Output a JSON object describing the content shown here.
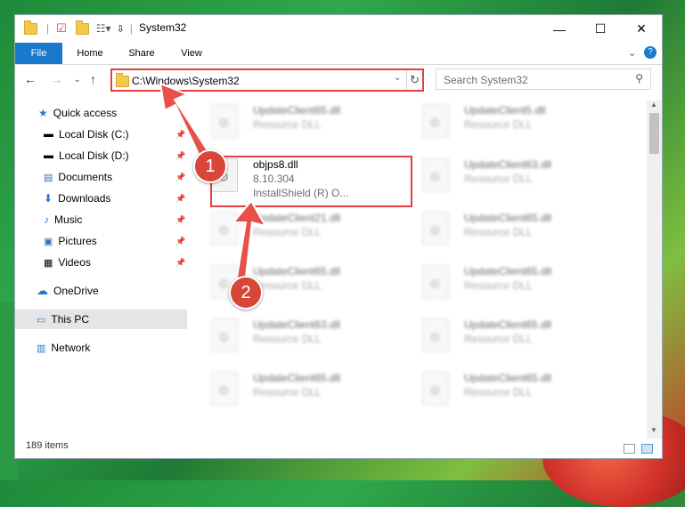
{
  "window": {
    "title": "System32"
  },
  "ribbon": {
    "tabs": [
      "File",
      "Home",
      "Share",
      "View"
    ]
  },
  "address": {
    "path": "C:\\Windows\\System32"
  },
  "search": {
    "placeholder": "Search System32"
  },
  "nav": {
    "quick_access": "Quick access",
    "items": [
      "Local Disk (C:)",
      "Local Disk (D:)",
      "Documents",
      "Downloads",
      "Music",
      "Pictures",
      "Videos"
    ],
    "onedrive": "OneDrive",
    "this_pc": "This PC",
    "network": "Network"
  },
  "files": {
    "highlighted": {
      "name": "objps8.dll",
      "version": "8.10.304",
      "company": "InstallShield (R) O..."
    },
    "left": [
      {
        "name": "UpdateClient65.dll",
        "type": "Resource DLL"
      },
      {
        "name": "UpdateClient21.dll",
        "type": "Resource DLL"
      },
      {
        "name": "UpdateClient65.dll",
        "type": "Resource DLL"
      },
      {
        "name": "UpdateClient63.dll",
        "type": "Resource DLL"
      },
      {
        "name": "UpdateClient65.dll",
        "type": "Resource DLL"
      }
    ],
    "right": [
      {
        "name": "UpdateClient5.dll",
        "type": "Resource DLL"
      },
      {
        "name": "UpdateClient63.dll",
        "type": "Resource DLL"
      },
      {
        "name": "UpdateClient65.dll",
        "type": "Resource DLL"
      },
      {
        "name": "UpdateClient65.dll",
        "type": "Resource DLL"
      },
      {
        "name": "UpdateClient65.dll",
        "type": "Resource DLL"
      },
      {
        "name": "UpdateClient65.dll",
        "type": "Resource DLL"
      }
    ]
  },
  "status": {
    "item_count": "189 items"
  },
  "callouts": [
    "1",
    "2"
  ],
  "colors": {
    "accent": "#1979ca",
    "highlight": "#e04040",
    "callout": "#d8463a"
  }
}
